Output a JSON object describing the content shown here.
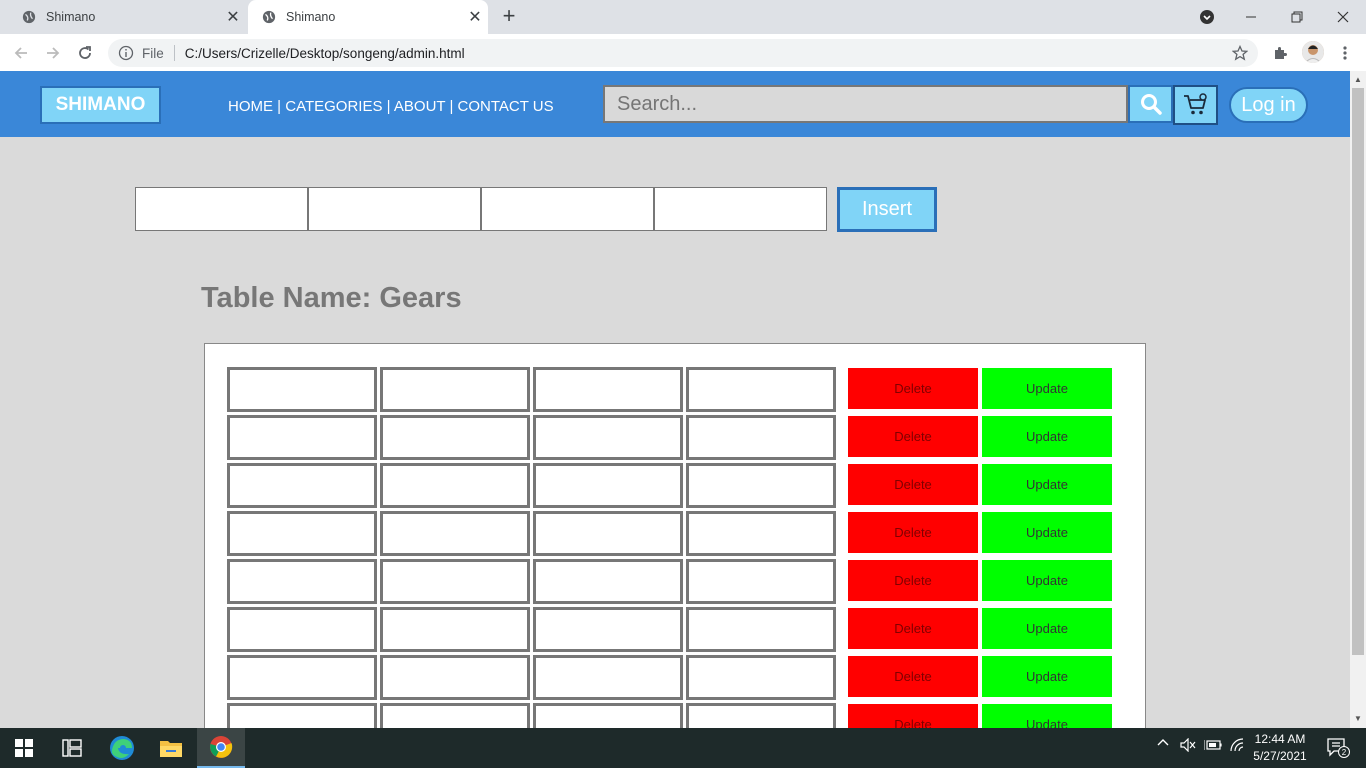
{
  "browser": {
    "tabs": [
      {
        "title": "Shimano",
        "active": false
      },
      {
        "title": "Shimano",
        "active": true
      }
    ],
    "address": {
      "scheme_label": "File",
      "url": "C:/Users/Crizelle/Desktop/songeng/admin.html"
    }
  },
  "header": {
    "logo": "SHIMANO",
    "nav": [
      {
        "label": "HOME"
      },
      {
        "label": "CATEGORIES"
      },
      {
        "label": "ABOUT"
      },
      {
        "label": "CONTACT US"
      }
    ],
    "nav_separator": " | ",
    "search_placeholder": "Search...",
    "login_label": "Log in"
  },
  "insert_form": {
    "fields": [
      "",
      "",
      "",
      ""
    ],
    "submit_label": "Insert"
  },
  "table": {
    "title": "Table Name: Gears",
    "delete_label": "Delete",
    "update_label": "Update",
    "rows": [
      {
        "cells": [
          "",
          "",
          "",
          ""
        ]
      },
      {
        "cells": [
          "",
          "",
          "",
          ""
        ]
      },
      {
        "cells": [
          "",
          "",
          "",
          ""
        ]
      },
      {
        "cells": [
          "",
          "",
          "",
          ""
        ]
      },
      {
        "cells": [
          "",
          "",
          "",
          ""
        ]
      },
      {
        "cells": [
          "",
          "",
          "",
          ""
        ]
      },
      {
        "cells": [
          "",
          "",
          "",
          ""
        ]
      },
      {
        "cells": [
          "",
          "",
          "",
          ""
        ]
      }
    ]
  },
  "taskbar": {
    "time": "12:44 AM",
    "date": "5/27/2021",
    "notification_count": "2"
  },
  "colors": {
    "header_bg": "#3a87d8",
    "accent_light_blue": "#80d4f7",
    "delete_red": "#ff0000",
    "update_green": "#00ff00",
    "page_bg": "#dadada"
  }
}
